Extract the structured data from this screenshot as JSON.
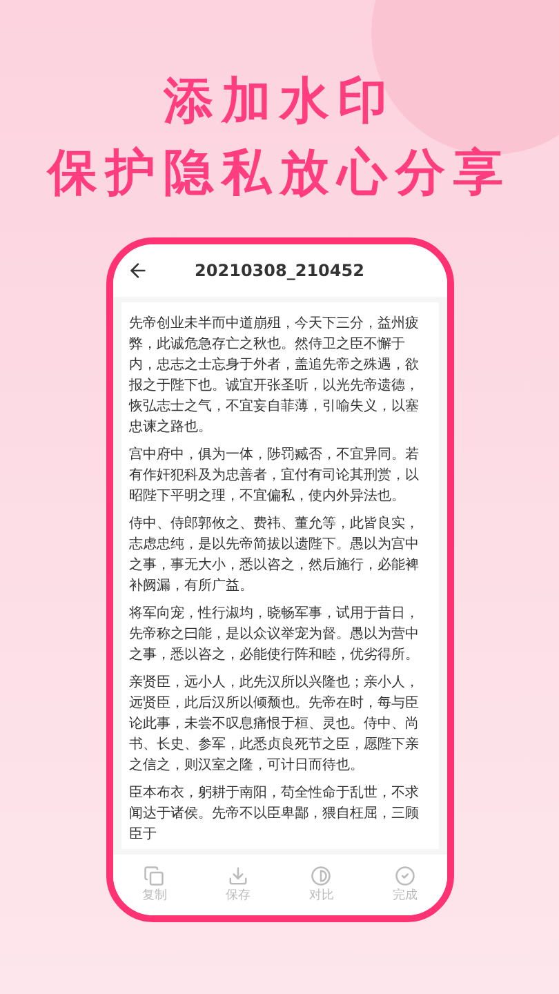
{
  "headline": [
    "添加水印",
    "保护隐私放心分享"
  ],
  "phone": {
    "title": "20210308_210452",
    "paragraphs": [
      "先帝创业未半而中道崩殂，今天下三分，益州疲弊，此诚危急存亡之秋也。然侍卫之臣不懈于内，忠志之士忘身于外者，盖追先帝之殊遇，欲报之于陛下也。诚宜开张圣听，以光先帝遗德，恢弘志士之气，不宜妄自菲薄，引喻失义，以塞忠谏之路也。",
      "宫中府中，俱为一体，陟罚臧否，不宜异同。若有作奸犯科及为忠善者，宜付有司论其刑赏，以昭陛下平明之理，不宜偏私，使内外异法也。",
      "侍中、侍郎郭攸之、费祎、董允等，此皆良实，志虑忠纯，是以先帝简拔以遗陛下。愚以为宫中之事，事无大小，悉以咨之，然后施行，必能裨补阙漏，有所广益。",
      "将军向宠，性行淑均，晓畅军事，试用于昔日，先帝称之曰能，是以众议举宠为督。愚以为营中之事，悉以咨之，必能使行阵和睦，优劣得所。",
      "亲贤臣，远小人，此先汉所以兴隆也；亲小人，远贤臣，此后汉所以倾颓也。先帝在时，每与臣论此事，未尝不叹息痛恨于桓、灵也。侍中、尚书、长史、参军，此悉贞良死节之臣，愿陛下亲之信之，则汉室之隆，可计日而待也。",
      "臣本布衣，躬耕于南阳，苟全性命于乱世，不求闻达于诸侯。先帝不以臣卑鄙，猥自枉屈，三顾臣于"
    ],
    "toolbar": [
      {
        "kind": "copy",
        "label": "复制"
      },
      {
        "kind": "save",
        "label": "保存"
      },
      {
        "kind": "compare",
        "label": "对比"
      },
      {
        "kind": "done",
        "label": "完成"
      }
    ]
  }
}
